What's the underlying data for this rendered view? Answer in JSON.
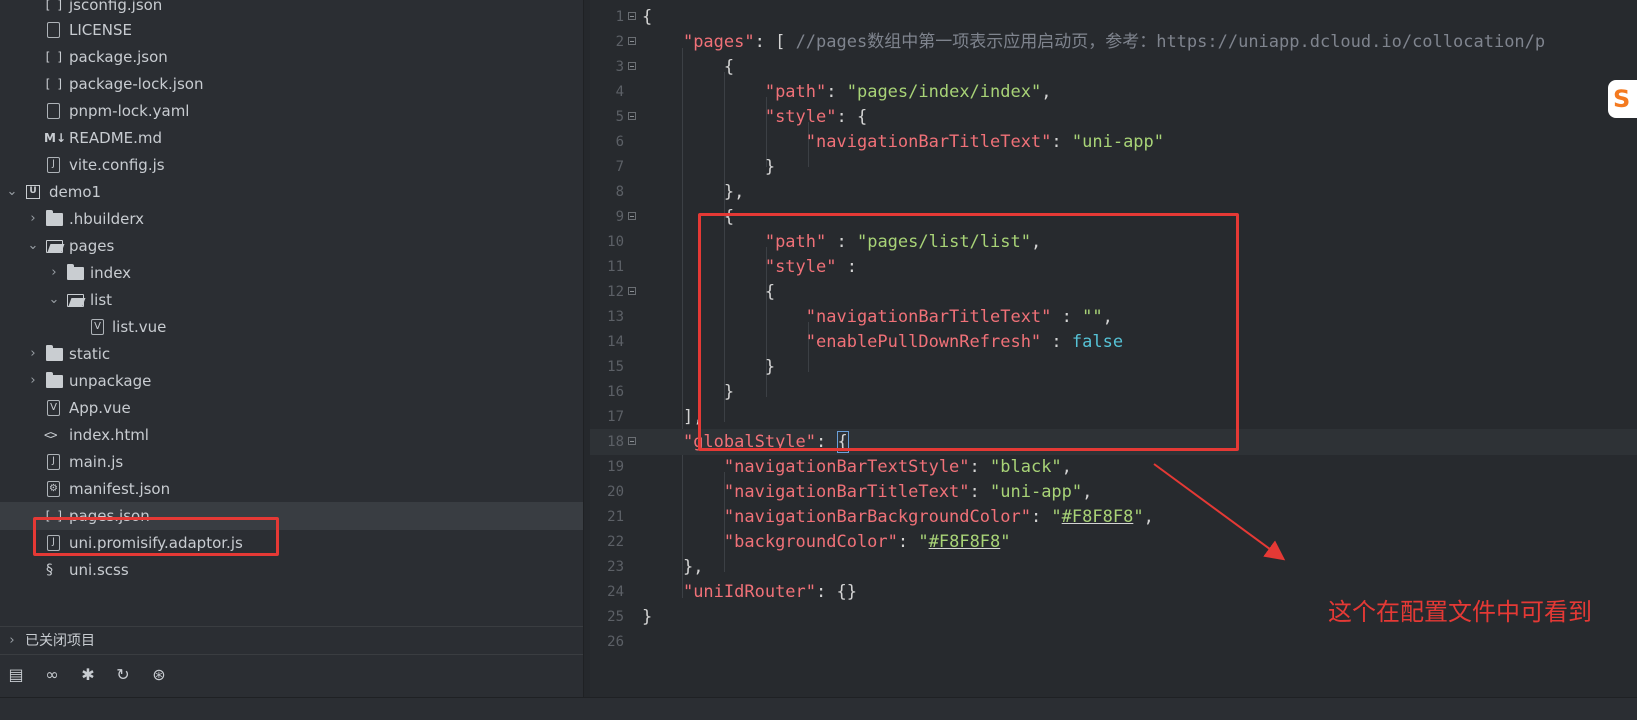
{
  "sidebar": {
    "items": [
      {
        "label": "jsconfig.json"
      },
      {
        "label": "LICENSE"
      },
      {
        "label": "package.json"
      },
      {
        "label": "package-lock.json"
      },
      {
        "label": "pnpm-lock.yaml"
      },
      {
        "label": "README.md"
      },
      {
        "label": "vite.config.js"
      },
      {
        "label": "demo1"
      },
      {
        "label": ".hbuilderx"
      },
      {
        "label": "pages"
      },
      {
        "label": "index"
      },
      {
        "label": "list"
      },
      {
        "label": "list.vue"
      },
      {
        "label": "static"
      },
      {
        "label": "unpackage"
      },
      {
        "label": "App.vue"
      },
      {
        "label": "index.html"
      },
      {
        "label": "main.js"
      },
      {
        "label": "manifest.json"
      },
      {
        "label": "pages.json"
      },
      {
        "label": "uni.promisify.adaptor.js"
      },
      {
        "label": "uni.scss"
      }
    ],
    "closed_projects": "已关闭项目",
    "toolbar": [
      "files-icon",
      "binoculars-icon",
      "bug-icon",
      "refresh-icon",
      "plugin-icon"
    ]
  },
  "editor": {
    "line_numbers": [
      "1",
      "2",
      "3",
      "4",
      "5",
      "6",
      "7",
      "8",
      "9",
      "10",
      "11",
      "12",
      "13",
      "14",
      "15",
      "16",
      "17",
      "18",
      "19",
      "20",
      "21",
      "22",
      "23",
      "24",
      "25",
      "26"
    ],
    "tokens": {
      "l1_open": "{",
      "k_pages": "\"pages\"",
      "l2_punct": ": [ ",
      "l2_comment": "//pages数组中第一项表示应用启动页，参考：https://uniapp.dcloud.io/collocation/p",
      "l3": "{",
      "k_path": "\"path\"",
      "colon": ": ",
      "s_index": "\"pages/index/index\"",
      "comma": ",",
      "k_style": "\"style\"",
      "brace_open": "{",
      "k_navTitle": "\"navigationBarTitleText\"",
      "s_uniapp": "\"uni-app\"",
      "l7": "}",
      "l8": "},",
      "l9": "{",
      "k_path2": "\"path\"",
      "spaced_colon": " : ",
      "s_list": "\"pages/list/list\"",
      "k_style2": "\"style\"",
      "spaced_colon_end": " :",
      "l12": "{",
      "k_navTitle2": "\"navigationBarTitleText\"",
      "s_empty": "\"\"",
      "k_pull": "\"enablePullDownRefresh\"",
      "b_false": "false",
      "l15": "}",
      "l16": "}",
      "l17": "],",
      "k_global": "\"globalStyle\"",
      "l18_brace": "{",
      "k_navTextStyle": "\"navigationBarTextStyle\"",
      "s_black": "\"black\"",
      "k_navTitle3": "\"navigationBarTitleText\"",
      "s_uniapp2": "\"uni-app\"",
      "k_navBg": "\"navigationBarBackgroundColor\"",
      "q": "\"",
      "hex1": "#F8F8F8",
      "k_bg": "\"backgroundColor\"",
      "hex2": "#F8F8F8",
      "l23": "},",
      "k_uniId": "\"uniIdRouter\"",
      "l24_val": "{}",
      "l25": "}"
    }
  },
  "annotation": {
    "text": "这个在配置文件中可看到",
    "color": "#e53935"
  },
  "badge": {
    "text": "S"
  },
  "colors": {
    "key": "#f07178",
    "string": "#a8d377",
    "comment": "#7f848e",
    "boolean": "#56c2d6",
    "highlight": "#e53935",
    "background": "#272a2e",
    "sidebar": "#2b2e33"
  }
}
